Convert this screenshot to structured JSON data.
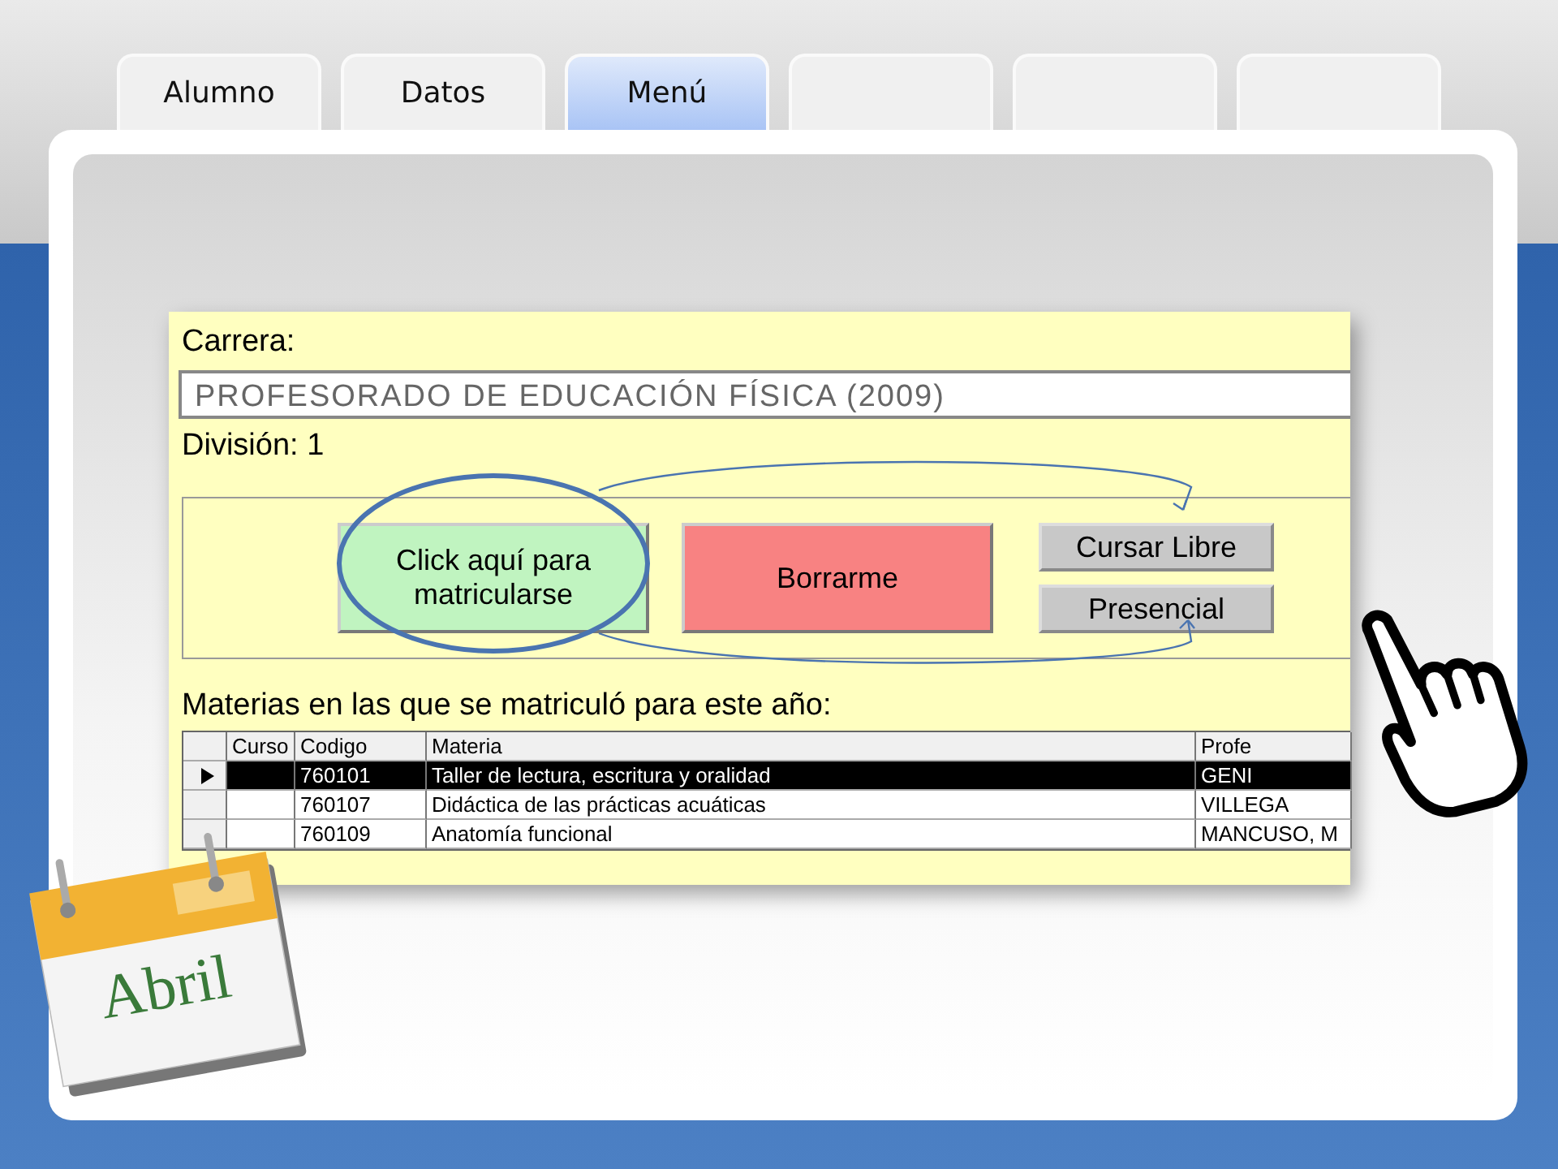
{
  "tabs": [
    {
      "label": "Alumno",
      "selected": false
    },
    {
      "label": "Datos",
      "selected": false
    },
    {
      "label": "Menú",
      "selected": true
    },
    {
      "selected": false
    },
    {
      "selected": false
    },
    {
      "selected": false
    }
  ],
  "form": {
    "career_label": "Carrera:",
    "career_value": "PROFESORADO DE EDUCACIÓN FÍSICA (2009)",
    "division": "División: 1",
    "buttons": [
      {
        "label": "Click aquí para matricularse",
        "kind": "large",
        "color": "#c0f4c0"
      },
      {
        "label": "Borrarme",
        "kind": "large",
        "color": "#f88282"
      },
      {
        "label": "Cursar Libre",
        "kind": "small",
        "color": "#c8c8c8"
      },
      {
        "label": "Presencial",
        "kind": "small",
        "color": "#c8c8c8"
      }
    ],
    "subjects_title": "Materias en las que se matriculó para este año:",
    "table": {
      "columns": [
        "Curso",
        "Codigo",
        "Materia",
        "Profe"
      ],
      "rows": [
        {
          "cells": [
            "",
            "760101",
            "Taller de lectura, escritura y oralidad",
            "GENI"
          ],
          "selected": true
        },
        {
          "cells": [
            "",
            "760107",
            "Didáctica de las prácticas acuáticas",
            "VILLEGA"
          ],
          "selected": false
        },
        {
          "cells": [
            "",
            "760109",
            "Anatomía funcional",
            "MANCUSO, M"
          ],
          "selected": false
        }
      ]
    }
  },
  "calendar": {
    "month": "Abril"
  }
}
